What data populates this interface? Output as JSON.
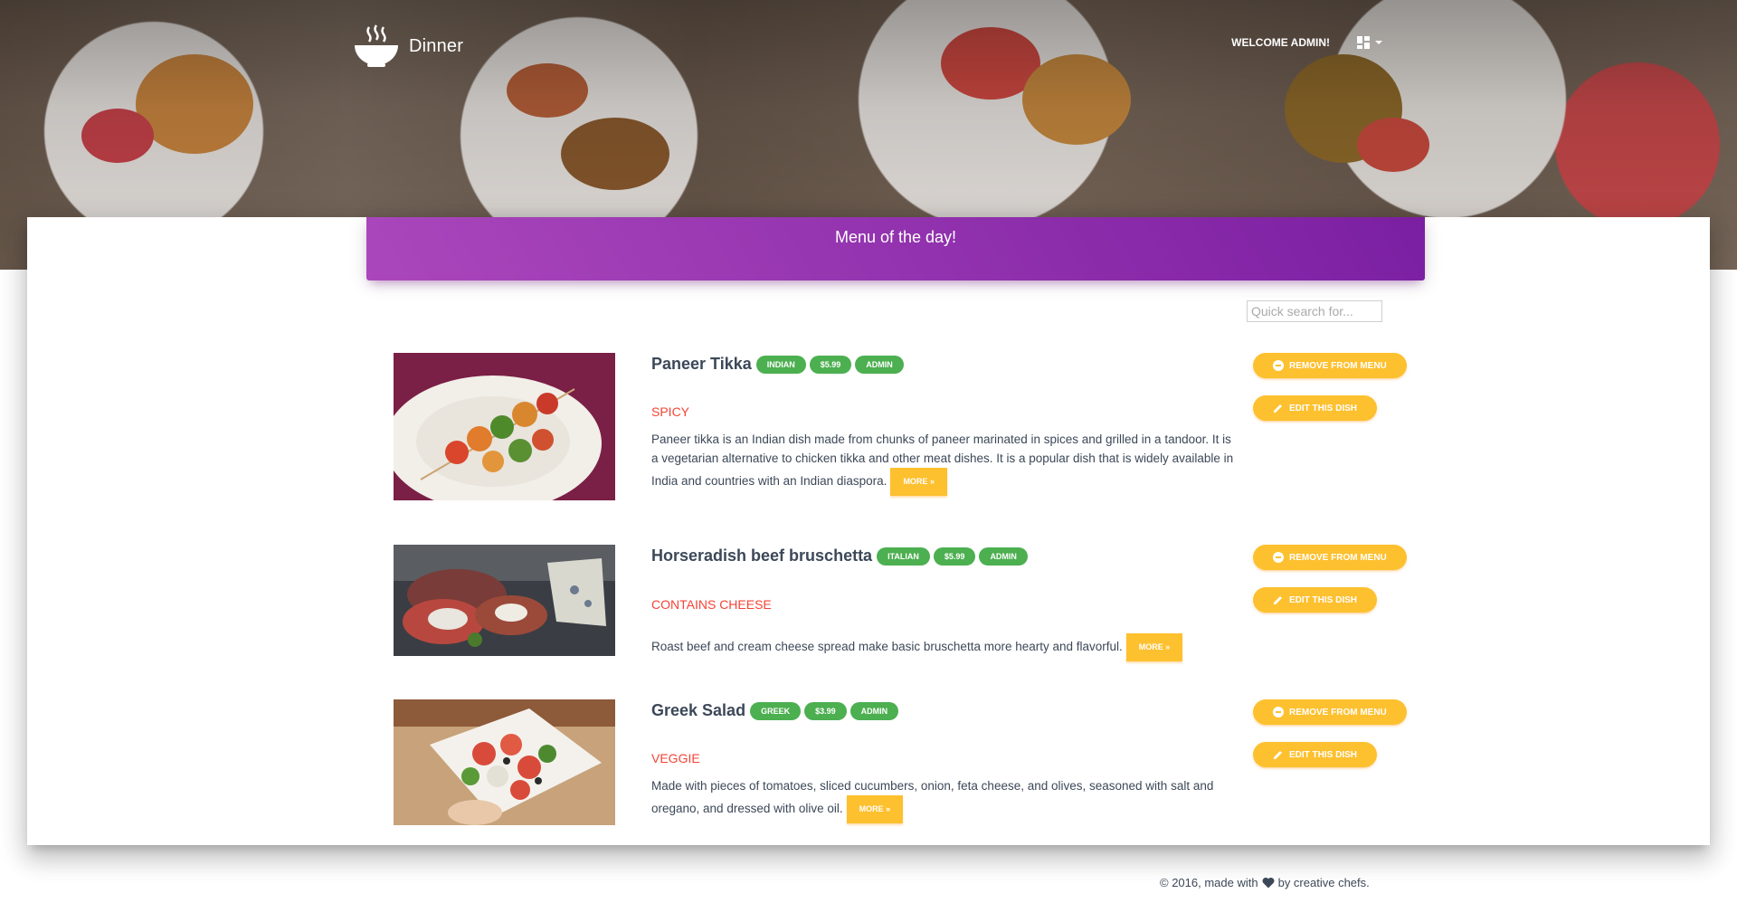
{
  "brand": {
    "name": "Dinner",
    "icon": "bowl-icon"
  },
  "nav": {
    "welcome": "WELCOME ADMIN!",
    "menu_icon": "dashboard-icon"
  },
  "menu": {
    "title": "Menu of the day!"
  },
  "search": {
    "placeholder": "Quick search for..."
  },
  "dishes": [
    {
      "name": "Paneer Tikka",
      "badges": [
        "INDIAN",
        "$5.99",
        "ADMIN"
      ],
      "tag": "SPICY",
      "description": "Paneer tikka is an Indian dish made from chunks of paneer marinated in spices and grilled in a tandoor. It is a vegetarian alternative to chicken tikka and other meat dishes. It is a popular dish that is widely available in India and countries with an Indian diaspora.",
      "more": "MORE »",
      "remove": "REMOVE FROM MENU",
      "edit": "EDIT THIS DISH"
    },
    {
      "name": "Horseradish beef bruschetta",
      "badges": [
        "ITALIAN",
        "$5.99",
        "ADMIN"
      ],
      "tag": "CONTAINS CHEESE",
      "description": "Roast beef and cream cheese spread make basic bruschetta more hearty and flavorful.",
      "more": "MORE »",
      "remove": "REMOVE FROM MENU",
      "edit": "EDIT THIS DISH"
    },
    {
      "name": "Greek Salad",
      "badges": [
        "GREEK",
        "$3.99",
        "ADMIN"
      ],
      "tag": "VEGGIE",
      "description": "Made with pieces of tomatoes, sliced cucumbers, onion, feta cheese, and olives, seasoned with salt and oregano, and dressed with olive oil.",
      "more": "MORE »",
      "remove": "REMOVE FROM MENU",
      "edit": "EDIT THIS DISH"
    }
  ],
  "footer": {
    "before": "© 2016, made with",
    "after": "by creative chefs.",
    "icon": "heart-icon"
  },
  "colors": {
    "accent": "#9c27b0",
    "warning": "#fdc02f",
    "success": "#4caf50",
    "danger": "#f44336"
  }
}
